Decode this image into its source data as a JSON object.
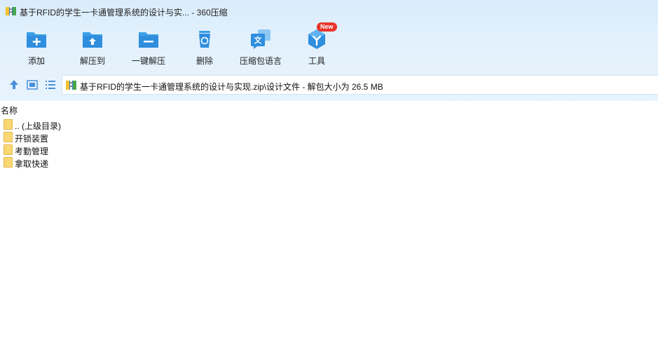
{
  "window": {
    "title": "基于RFID的学生一卡通管理系统的设计与实... - 360压缩",
    "app_icon": "archive-icon"
  },
  "toolbar": {
    "items": [
      {
        "label": "添加",
        "icon": "folder-plus-icon"
      },
      {
        "label": "解压到",
        "icon": "folder-upload-icon"
      },
      {
        "label": "一键解压",
        "icon": "folder-minus-icon"
      },
      {
        "label": "删除",
        "icon": "recycle-bin-icon"
      },
      {
        "label": "压缩包语言",
        "icon": "language-icon"
      },
      {
        "label": "工具",
        "icon": "tools-cube-icon",
        "badge": "New"
      }
    ]
  },
  "nav": {
    "up_icon": "up-arrow-icon",
    "view_icon": "thumbnail-view-icon",
    "list_icon": "list-view-icon",
    "path": "基于RFID的学生一卡通管理系统的设计与实现.zip\\设计文件 - 解包大小为 26.5 MB"
  },
  "list": {
    "column_name": "名称",
    "items": [
      {
        "name": ".. (上级目录)"
      },
      {
        "name": "开锁装置"
      },
      {
        "name": "考勤管理"
      },
      {
        "name": "拿取快递"
      }
    ]
  },
  "colors": {
    "accent": "#3a9ee6",
    "band": "#e3f1fc",
    "folder": "#fbd774",
    "badge": "#e8342c"
  }
}
